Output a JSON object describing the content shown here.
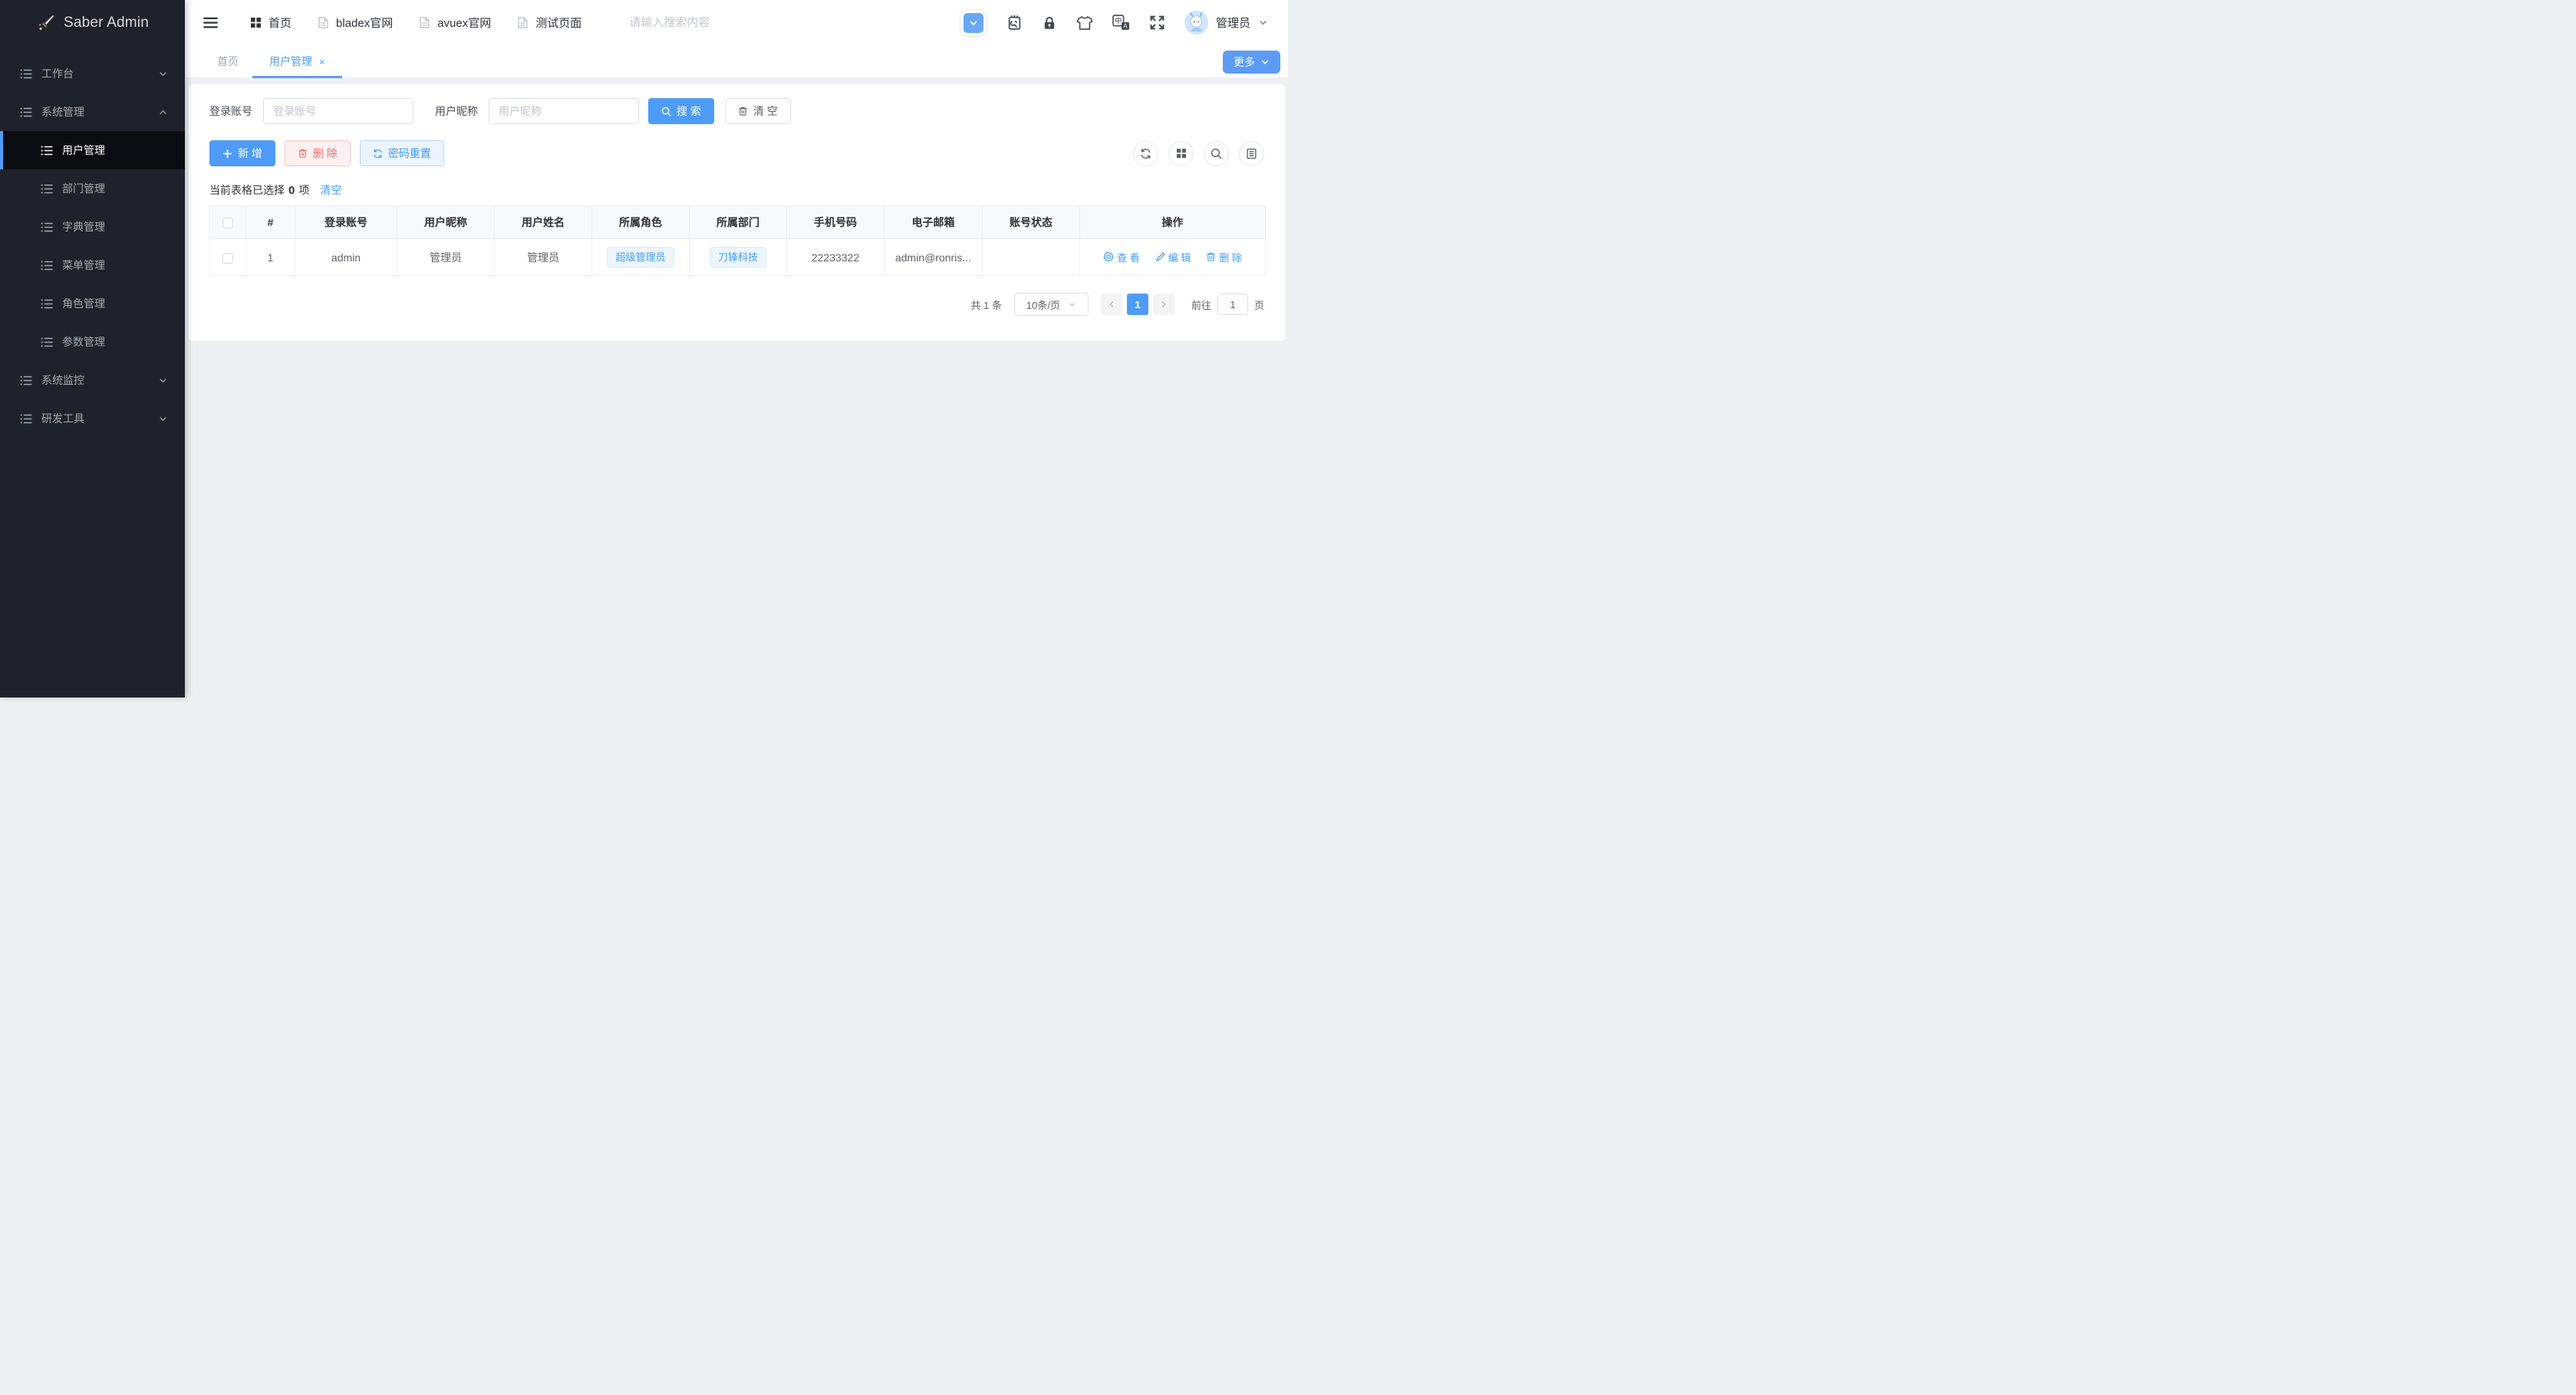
{
  "app": {
    "logo_text": "Saber Admin"
  },
  "colors": {
    "accent": "#409eff",
    "primary_button": "#4e9cf7",
    "danger": "#f56c6c",
    "danger_bg": "#fef0f0",
    "info_bg": "#ecf5ff",
    "sidebar_bg": "#1f222a",
    "sidebar_active_bg": "#0a0c11",
    "content_bg": "#eef0f4",
    "tag_border": "#d9ecff"
  },
  "icons": {
    "logo": "sword-icon",
    "nav_home": "grid-icon",
    "nav_page": "document-icon",
    "header": [
      "collapse-toggle-icon",
      "debug-tool-icon",
      "lock-icon",
      "theme-shirt-icon",
      "translate-icon",
      "fullscreen-icon"
    ],
    "table_toolbar": [
      "refresh-icon",
      "grid-icon",
      "search-icon",
      "document-lines-icon"
    ],
    "row_actions": [
      "eye-icon",
      "pencil-icon",
      "trash-icon"
    ]
  },
  "sidebar": {
    "items": [
      {
        "label": "工作台",
        "state": "collapsed"
      },
      {
        "label": "系统管理",
        "state": "expanded",
        "children": [
          {
            "label": "用户管理",
            "active": true
          },
          {
            "label": "部门管理"
          },
          {
            "label": "字典管理"
          },
          {
            "label": "菜单管理"
          },
          {
            "label": "角色管理"
          },
          {
            "label": "参数管理"
          }
        ]
      },
      {
        "label": "系统监控",
        "state": "collapsed"
      },
      {
        "label": "研发工具",
        "state": "collapsed"
      }
    ]
  },
  "topbar": {
    "nav": [
      {
        "label": "首页",
        "icon": "grid-icon"
      },
      {
        "label": "bladex官网",
        "icon": "document-icon"
      },
      {
        "label": "avuex官网",
        "icon": "document-icon"
      },
      {
        "label": "测试页面",
        "icon": "document-icon"
      }
    ],
    "search_placeholder": "请输入搜索内容",
    "user": "管理员"
  },
  "tabs": {
    "items": [
      {
        "label": "首页",
        "active": false
      },
      {
        "label": "用户管理",
        "active": true,
        "close_glyph": "×"
      }
    ],
    "more_label": "更多"
  },
  "filters": {
    "account_label": "登录账号",
    "account_placeholder": "登录账号",
    "account_value": "",
    "nickname_label": "用户昵称",
    "nickname_placeholder": "用户昵称",
    "nickname_value": "",
    "search_label": "搜 索",
    "clear_label": "清 空"
  },
  "toolbar": {
    "add_label": "新 增",
    "delete_label": "删 除",
    "reset_pwd_label": "密码重置"
  },
  "selection": {
    "prefix": "当前表格已选择",
    "count": "0",
    "suffix": "项",
    "clear_label": "清空"
  },
  "table": {
    "columns": [
      "#",
      "登录账号",
      "用户昵称",
      "用户姓名",
      "所属角色",
      "所属部门",
      "手机号码",
      "电子邮箱",
      "账号状态",
      "操作"
    ],
    "rows": [
      {
        "index": "1",
        "account": "admin",
        "nickname": "管理员",
        "name": "管理员",
        "role": "超级管理员",
        "dept": "刀锋科技",
        "phone": "22233322",
        "email": "admin@ronris...",
        "status": "",
        "actions": {
          "view": "查 看",
          "edit": "编 辑",
          "delete": "删 除"
        }
      }
    ]
  },
  "pagination": {
    "total": "共 1 条",
    "page_size": "10条/页",
    "current_page": "1",
    "goto_label": "前往",
    "goto_value": "1",
    "page_label": "页"
  }
}
